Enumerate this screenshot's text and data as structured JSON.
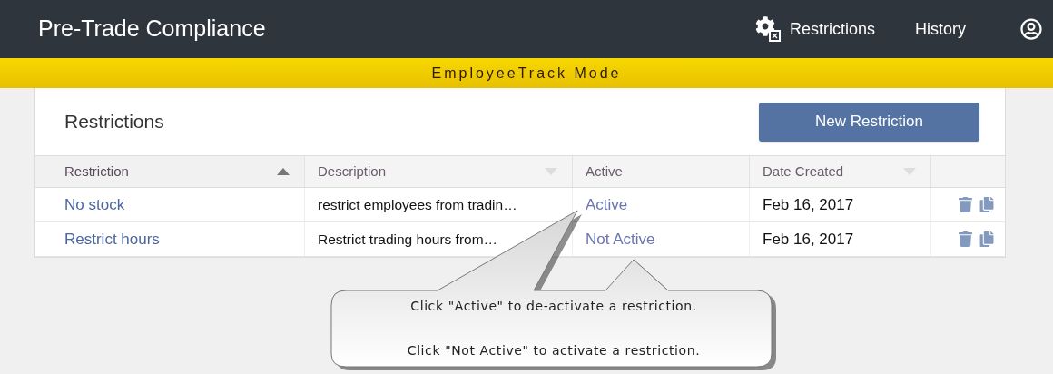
{
  "header": {
    "title": "Pre-Trade Compliance",
    "nav": [
      {
        "label": "Restrictions",
        "kind": "gear"
      },
      {
        "label": "History",
        "kind": "plain"
      }
    ]
  },
  "banner": {
    "text": "EmployeeTrack Mode"
  },
  "panel": {
    "title": "Restrictions",
    "button": "New Restriction"
  },
  "table": {
    "columns": [
      {
        "label": "Restriction",
        "sortable": true,
        "sorted": true
      },
      {
        "label": "Description",
        "sortable": true,
        "sorted": false
      },
      {
        "label": "Active",
        "sortable": false
      },
      {
        "label": "Date Created",
        "sortable": true,
        "sorted": false
      }
    ],
    "rows": [
      {
        "restriction": "No stock",
        "description": "restrict employees from tradin…",
        "active": "Active",
        "date_created": "Feb 16, 2017"
      },
      {
        "restriction": "Restrict hours",
        "description": "Restrict trading hours from…",
        "active": "Not Active",
        "date_created": "Feb 16, 2017"
      }
    ]
  },
  "callout": {
    "lines": [
      "Click \"Active\" to de-activate a restriction.",
      "Click \"Not Active\" to activate a restriction."
    ]
  }
}
